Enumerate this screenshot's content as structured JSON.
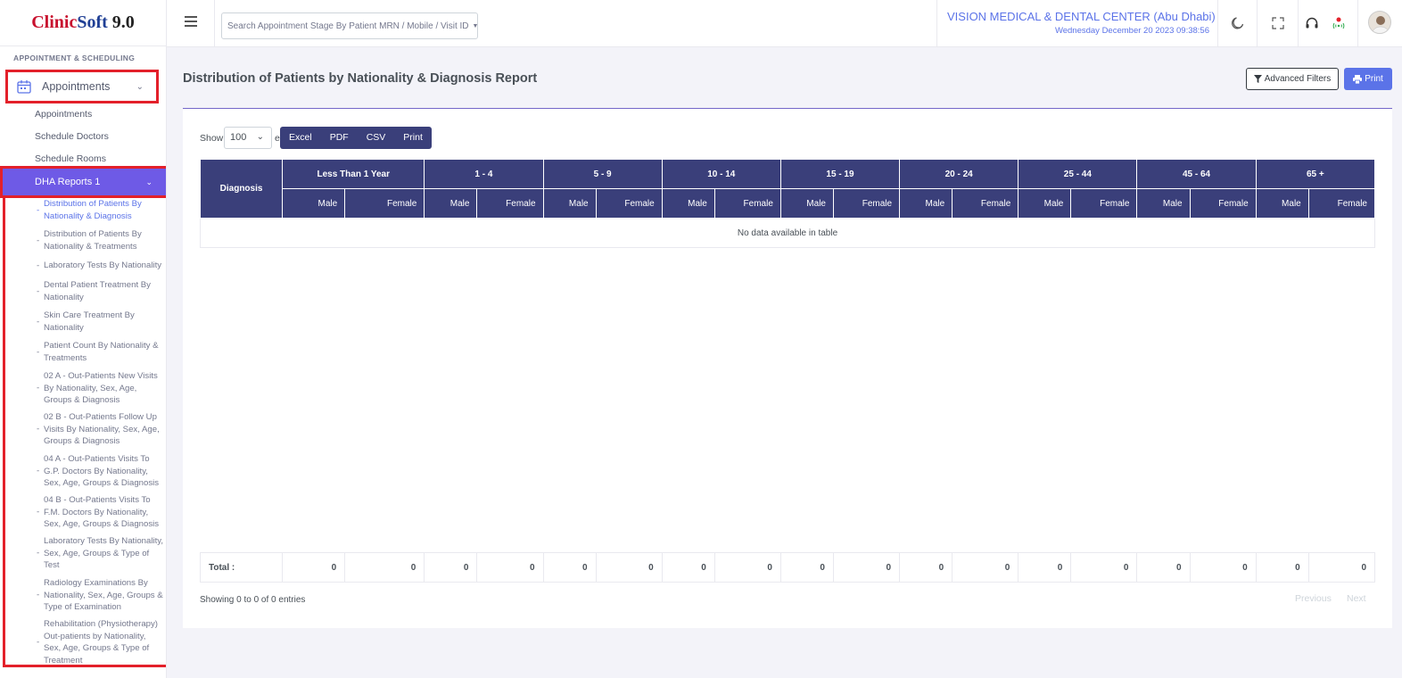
{
  "app": {
    "logo_part1": "Clinic",
    "logo_part2": "Soft",
    "logo_version": "9.0"
  },
  "sidebar": {
    "menu_title": "APPOINTMENT & SCHEDULING",
    "appointments_label": "Appointments",
    "sub_items": [
      "Appointments",
      "Schedule Doctors",
      "Schedule Rooms"
    ],
    "dha_label": "DHA Reports 1",
    "reports": [
      "Distribution of Patients By Nationality & Diagnosis",
      "Distribution of Patients By Nationality & Treatments",
      "Laboratory Tests By Nationality",
      "Dental Patient Treatment By Nationality",
      "Skin Care Treatment By Nationality",
      "Patient Count By Nationality & Treatments",
      "02 A - Out-Patients New Visits By Nationality, Sex, Age, Groups & Diagnosis",
      "02 B - Out-Patients Follow Up Visits By Nationality, Sex, Age, Groups & Diagnosis",
      "04 A - Out-Patients Visits To G.P. Doctors By Nationality, Sex, Age, Groups & Diagnosis",
      "04 B - Out-Patients Visits To F.M. Doctors By Nationality, Sex, Age, Groups & Diagnosis",
      "Laboratory Tests By Nationality, Sex, Age, Groups & Type of Test",
      "Radiology Examinations By Nationality, Sex, Age, Groups & Type of Examination",
      "Rehabilitation (Physiotherapy) Out-patients by Nationality, Sex, Age, Groups & Type of Treatment"
    ]
  },
  "topbar": {
    "search_placeholder": "Search Appointment Stage By Patient MRN / Mobile / Visit ID",
    "center_name": "VISION MEDICAL & DENTAL CENTER (Abu Dhabi)",
    "datetime": "Wednesday December 20 2023 09:38:56"
  },
  "main": {
    "title": "Distribution of Patients by Nationality & Diagnosis Report",
    "advanced_filters": "Advanced Filters",
    "print": "Print",
    "show_label": "Show",
    "show_value": "100",
    "entries_fragment": "e",
    "export_buttons": [
      "Excel",
      "PDF",
      "CSV",
      "Print"
    ],
    "table": {
      "first_col": "Diagnosis",
      "age_groups": [
        "Less Than 1 Year",
        "1 - 4",
        "5 - 9",
        "10 - 14",
        "15 - 19",
        "20 - 24",
        "25 - 44",
        "45 - 64",
        "65 +"
      ],
      "male": "Male",
      "female": "Female",
      "empty_message": "No data available in table",
      "total_label": "Total :",
      "totals": [
        "0",
        "0",
        "0",
        "0",
        "0",
        "0",
        "0",
        "0",
        "0",
        "0",
        "0",
        "0",
        "0",
        "0",
        "0",
        "0",
        "0",
        "0"
      ]
    },
    "showing": "Showing 0 to 0 of 0 entries",
    "previous": "Previous",
    "next": "Next"
  },
  "colors": {
    "accent": "#5b73e8",
    "header_bg": "#3a3f7a",
    "dha_bg": "#6e5ae6",
    "highlight": "#e3202a"
  }
}
